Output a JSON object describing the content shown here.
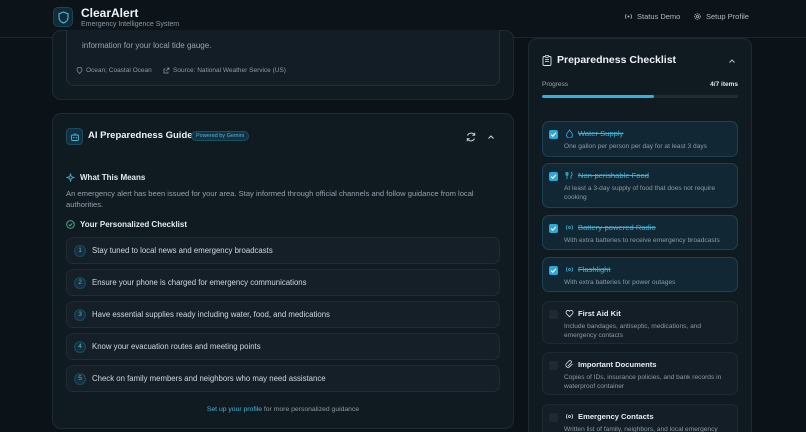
{
  "header": {
    "app_title": "ClearAlert",
    "app_subtitle": "Emergency Intelligence System",
    "status_demo": "Status Demo",
    "setup_profile": "Setup Profile"
  },
  "alert_card": {
    "info_text": "information for your local tide gauge.",
    "location": "Ocean; Coastal Ocean",
    "source": "Source: National Weather Service (US)"
  },
  "guide": {
    "title": "AI Preparedness Guide",
    "badge": "Powered by Gemini",
    "what_heading": "What This Means",
    "what_text": "An emergency alert has been issued for your area. Stay informed through official channels and follow guidance from local authorities.",
    "checklist_heading": "Your Personalized Checklist",
    "steps": [
      {
        "num": "1",
        "text": "Stay tuned to local news and emergency broadcasts"
      },
      {
        "num": "2",
        "text": "Ensure your phone is charged for emergency communications"
      },
      {
        "num": "3",
        "text": "Have essential supplies ready including water, food, and medications"
      },
      {
        "num": "4",
        "text": "Know your evacuation routes and meeting points"
      },
      {
        "num": "5",
        "text": "Check on family members and neighbors who may need assistance"
      }
    ],
    "footer_link": "Set up your profile",
    "footer_rest": " for more personalized guidance"
  },
  "checklist": {
    "title": "Preparedness Checklist",
    "progress_label": "Progress",
    "progress_count": "4/7 items",
    "progress_fraction": 0.57,
    "items": [
      {
        "name": "Water Supply",
        "desc": "One gallon per person per day for at least 3 days",
        "done": true,
        "icon": "droplet-icon"
      },
      {
        "name": "Non-perishable Food",
        "desc": "At least a 3-day supply of food that does not require cooking",
        "done": true,
        "icon": "food-icon"
      },
      {
        "name": "Battery-powered Radio",
        "desc": "With extra batteries to receive emergency broadcasts",
        "done": true,
        "icon": "radio-icon"
      },
      {
        "name": "Flashlight",
        "desc": "With extra batteries for power outages",
        "done": true,
        "icon": "flashlight-icon"
      },
      {
        "name": "First Aid Kit",
        "desc": "Include bandages, antiseptic, medications, and emergency contacts",
        "done": false,
        "icon": "heart-icon"
      },
      {
        "name": "Important Documents",
        "desc": "Copies of IDs, insurance policies, and bank records in waterproof container",
        "done": false,
        "icon": "document-icon"
      },
      {
        "name": "Emergency Contacts",
        "desc": "Written list of family, neighbors, and local emergency",
        "done": false,
        "icon": "broadcast-icon"
      }
    ]
  },
  "colors": {
    "accent": "#2fb3dc",
    "background": "#0b1218",
    "card": "#101a21"
  }
}
